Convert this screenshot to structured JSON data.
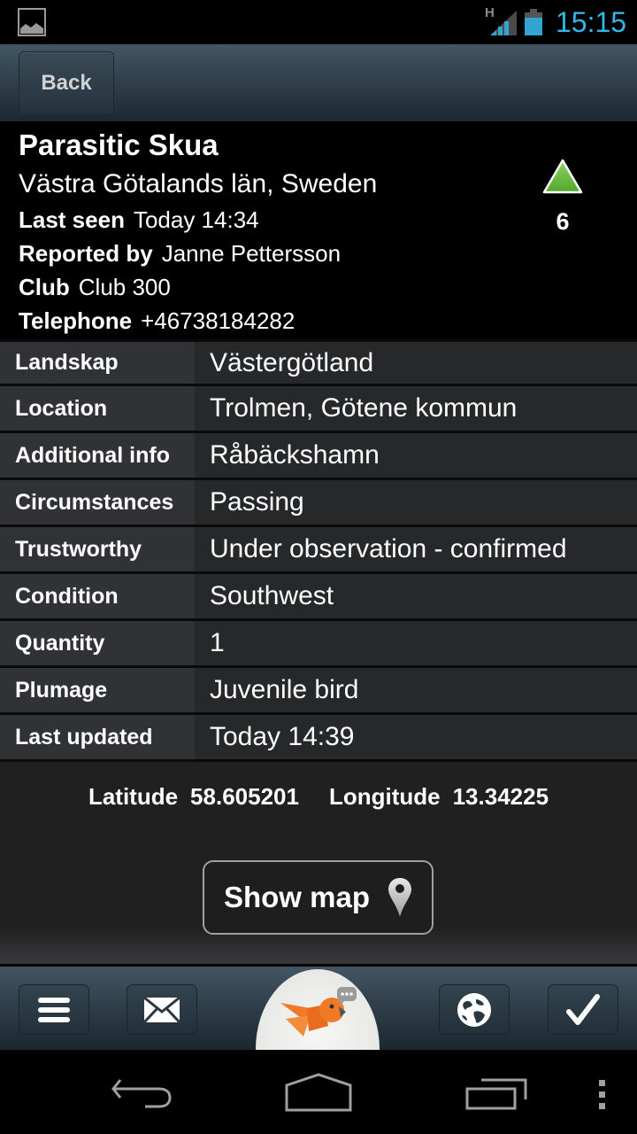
{
  "status_bar": {
    "notification_icon": "gallery-image-icon",
    "network_type": "H",
    "signal_icon": "signal-icon",
    "battery_icon": "battery-icon",
    "time": "15:15"
  },
  "action_bar": {
    "back_label": "Back"
  },
  "sighting": {
    "species": "Parasitic Skua",
    "region": "Västra Götalands län, Sweden",
    "last_seen_label": "Last seen",
    "last_seen_value": "Today 14:34",
    "reported_by_label": "Reported by",
    "reported_by_value": "Janne Pettersson",
    "club_label": "Club",
    "club_value": "Club 300",
    "telephone_label": "Telephone",
    "telephone_value": "+46738184282",
    "rank_icon": "green-up-triangle-icon",
    "rank_value": "6",
    "rank_color": "#6cc04a"
  },
  "details": [
    {
      "label": "Landskap",
      "value": "Västergötland"
    },
    {
      "label": "Location",
      "value": "Trolmen, Götene kommun"
    },
    {
      "label": "Additional info",
      "value": "Råbäckshamn"
    },
    {
      "label": "Circumstances",
      "value": "Passing"
    },
    {
      "label": "Trustworthy",
      "value": "Under observation - confirmed"
    },
    {
      "label": "Condition",
      "value": "Southwest"
    },
    {
      "label": "Quantity",
      "value": "1"
    },
    {
      "label": "Plumage",
      "value": "Juvenile bird"
    },
    {
      "label": "Last updated",
      "value": "Today 14:39"
    }
  ],
  "coordinates": {
    "latitude_label": "Latitude",
    "latitude_value": "58.605201",
    "longitude_label": "Longitude",
    "longitude_value": "13.34225"
  },
  "show_map": {
    "label": "Show map",
    "icon": "map-pin-icon"
  },
  "bottom_bar": {
    "items": [
      {
        "name": "menu",
        "icon": "menu-icon"
      },
      {
        "name": "mail",
        "icon": "mail-icon"
      },
      {
        "name": "app-logo",
        "icon": "orange-bird-logo-icon"
      },
      {
        "name": "web",
        "icon": "globe-icon"
      },
      {
        "name": "confirm",
        "icon": "checkmark-icon"
      }
    ]
  },
  "nav_bar": {
    "back": "nav-back-icon",
    "home": "nav-home-icon",
    "recents": "nav-recents-icon",
    "overflow": "overflow-menu-icon"
  }
}
